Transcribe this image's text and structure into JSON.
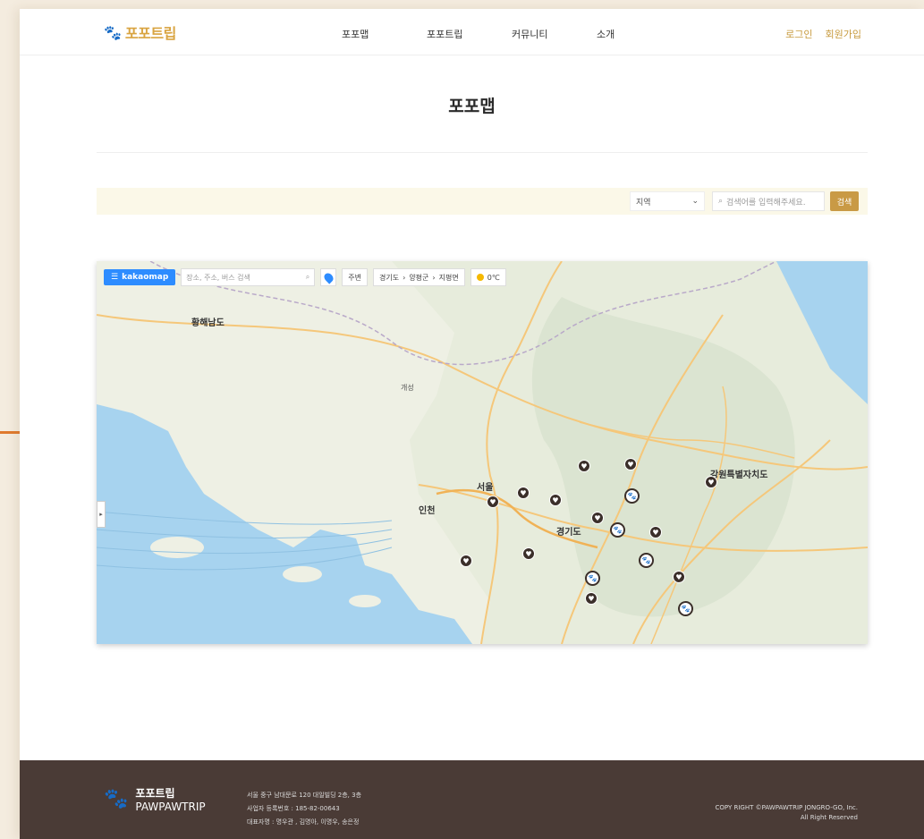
{
  "header": {
    "logo_text": "포포트립",
    "nav": [
      "포포맵",
      "포포트립",
      "커뮤니티",
      "소개"
    ],
    "login": "로그인",
    "signup": "회원가입"
  },
  "page": {
    "title": "포포맵"
  },
  "search": {
    "region_value": "지역",
    "placeholder": "검색어를 입력해주세요.",
    "button": "검색"
  },
  "map": {
    "brand": "kakaomap",
    "search_placeholder": "장소, 주소, 버스 검색",
    "route_label": "주변",
    "breadcrumb": [
      "경기도",
      "양평군",
      "지평면"
    ],
    "weather": "0℃",
    "labels": [
      {
        "text": "황해남도",
        "big": true
      },
      {
        "text": "개성",
        "big": false
      },
      {
        "text": "서울",
        "big": true
      },
      {
        "text": "인천",
        "big": true
      },
      {
        "text": "경기도",
        "big": true
      },
      {
        "text": "강원특별자치도",
        "big": true
      }
    ]
  },
  "footer": {
    "brand_ko": "포포트립",
    "brand_en": "PAWPAWTRIP",
    "address": "서울 중구 남대문로 120 대일빌딩 2층, 3층",
    "biz_no": "사업자 등록번호 : 185-82-00643",
    "ceo": "대표자명 : 명우관 , 김명아, 이명우, 송은정",
    "copyright": "COPY RIGHT ©PAWPAWTRIP JONGRO-GO, Inc.",
    "rights": "All Right Reserved"
  },
  "colors": {
    "accent": "#c99a45",
    "footer_bg": "#4a3b36",
    "kakao_blue": "#2d8cff"
  }
}
